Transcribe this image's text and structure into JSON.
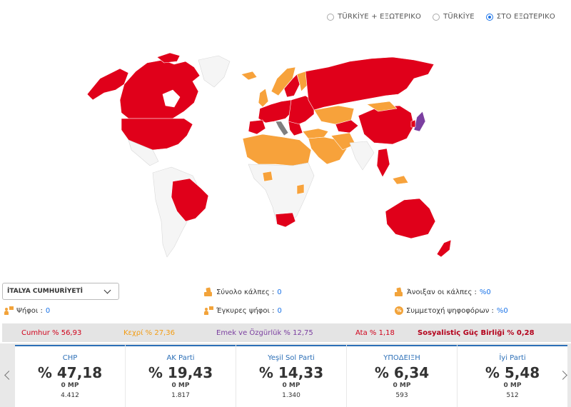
{
  "scope_options": [
    {
      "label": "TÜRKİYE + ΕΞΩΤΕΡΙΚΟ",
      "selected": false
    },
    {
      "label": "TÜRKİYE",
      "selected": false
    },
    {
      "label": "ΣΤΟ ΕΞΩΤΕΡΙΚΟ",
      "selected": true
    }
  ],
  "map_colors": {
    "winner_red": "#e0001a",
    "second_orange": "#f7a23b",
    "other_purple": "#7b3fa0",
    "no_data_gray": "#f5f5f5",
    "border": "#ffffff"
  },
  "country_select": {
    "value": "İTALYA CUMHURİYETİ"
  },
  "stats": {
    "total_boxes_label": "Σύνολο κάλπες :",
    "total_boxes_value": "0",
    "opened_boxes_label": "Άνοιξαν οι κάλπες :",
    "opened_boxes_value": "%0",
    "votes_label": "Ψήφοι :",
    "votes_value": "0",
    "valid_votes_label": "Έγκυρες ψήφοι :",
    "valid_votes_value": "0",
    "turnout_label": "Συμμετοχή ψηφοφόρων :",
    "turnout_value": "%0"
  },
  "alliances": [
    {
      "text": "Cumhur % 56,93",
      "color": "#d0021b",
      "bold": false
    },
    {
      "text": "Kεχρί % 27,36",
      "color": "#f39c12",
      "bold": false
    },
    {
      "text": "Emek ve Özgürlük % 12,75",
      "color": "#7b3fa0",
      "bold": false
    },
    {
      "text": "Ata % 1,18",
      "color": "#d0021b",
      "bold": false
    },
    {
      "text": "Sosyalistiς Güç Birliği % 0,28",
      "color": "#b3001b",
      "bold": true
    }
  ],
  "parties": [
    {
      "name": "CHP",
      "pct": "% 47,18",
      "mp": "0 MP",
      "votes": "4.412"
    },
    {
      "name": "AK Parti",
      "pct": "% 19,43",
      "mp": "0 MP",
      "votes": "1.817"
    },
    {
      "name": "Yeşil Sol Parti",
      "pct": "% 14,33",
      "mp": "0 MP",
      "votes": "1.340"
    },
    {
      "name": "ΥΠΟΔΕΙΞΗ",
      "pct": "% 6,34",
      "mp": "0 MP",
      "votes": "593"
    },
    {
      "name": "İyi Parti",
      "pct": "% 5,48",
      "mp": "0 MP",
      "votes": "512"
    }
  ]
}
